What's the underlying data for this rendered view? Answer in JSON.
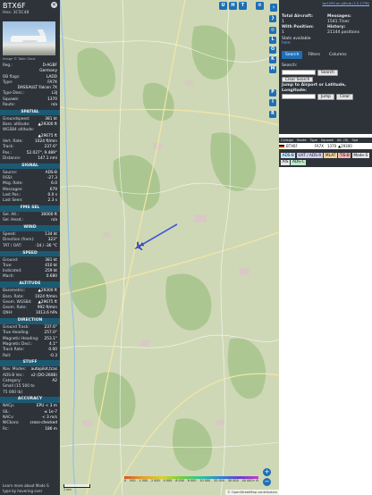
{
  "infoblock": {
    "callsign": "BTX6F",
    "hex_line": "Hex: 3C5C48",
    "photo_credit": "Image © Tobin Zouk",
    "ident_rows": [
      {
        "k": "Reg.:",
        "v": "D-AGBF"
      },
      {
        "k": "",
        "v": "Germany"
      },
      {
        "k": "DB flags:",
        "v": "LADD"
      },
      {
        "k": "Type:",
        "v": "FA7X"
      },
      {
        "k": "",
        "v": "DASSAULT Falcon 7X"
      },
      {
        "k": "Type Desc.:",
        "v": "L3J"
      },
      {
        "k": "Squawk:",
        "v": "1370"
      },
      {
        "k": "Route:",
        "v": "n/a"
      }
    ],
    "sections": [
      {
        "title": "SPATIAL",
        "rows": [
          {
            "k": "Groundspeed:",
            "v": "381 kt"
          },
          {
            "k": "Baro. altitude:",
            "v": "▲29300 ft"
          },
          {
            "k": "WGS84 altitude:",
            "v": ""
          },
          {
            "k": "",
            "v": "▲29675 ft"
          },
          {
            "k": "Vert. Rate:",
            "v": "1024 ft/min"
          },
          {
            "k": "Track:",
            "v": "237.6°"
          },
          {
            "k": "Pos.:",
            "v": "52.027°, 9.489°"
          },
          {
            "k": "Distance:",
            "v": "147.1 nmi"
          }
        ]
      },
      {
        "title": "SIGNAL",
        "rows": [
          {
            "k": "Source:",
            "v": "ADS-B"
          },
          {
            "k": "RSSI:",
            "v": "-27.3"
          },
          {
            "k": "Msg. Rate:",
            "v": "6.0"
          },
          {
            "k": "Messages:",
            "v": "679"
          },
          {
            "k": "Last Pos.:",
            "v": "0.0 s"
          },
          {
            "k": "Last Seen:",
            "v": "2.3 s"
          }
        ]
      },
      {
        "title": "FMS SEL",
        "rows": [
          {
            "k": "Sel. Alt.:",
            "v": "30000 ft"
          },
          {
            "k": "Sel. Head.:",
            "v": "n/a"
          }
        ]
      },
      {
        "title": "WIND",
        "rows": [
          {
            "k": "Speed:",
            "v": "134 kt"
          },
          {
            "k": "Direction (from):",
            "v": "323°"
          },
          {
            "k": "TAT / OAT:",
            "v": "-14 / -36 °C"
          }
        ]
      },
      {
        "title": "SPEED",
        "rows": [
          {
            "k": "Ground:",
            "v": "381 kt"
          },
          {
            "k": "True:",
            "v": "410 kt"
          },
          {
            "k": "Indicated:",
            "v": "259 kt"
          },
          {
            "k": "Mach:",
            "v": "0.680"
          }
        ]
      },
      {
        "title": "ALTITUDE",
        "rows": [
          {
            "k": "Barometric:",
            "v": "▲29300 ft"
          },
          {
            "k": "Baro. Rate:",
            "v": "1024 ft/min"
          },
          {
            "k": "Geom. WGS84:",
            "v": "▲29675 ft"
          },
          {
            "k": "Geom. Rate:",
            "v": "992 ft/min"
          },
          {
            "k": "QNH:",
            "v": "1013.6 hPa"
          }
        ]
      },
      {
        "title": "DIRECTION",
        "rows": [
          {
            "k": "Ground Track:",
            "v": "237.6°"
          },
          {
            "k": "True Heading:",
            "v": "257.0°"
          },
          {
            "k": "Magnetic Heading:",
            "v": "253.1°"
          },
          {
            "k": "Magnetic Decl.:",
            "v": "4.1°"
          },
          {
            "k": "Track Rate:",
            "v": "0.00"
          },
          {
            "k": "Roll:",
            "v": "-0.3"
          }
        ]
      },
      {
        "title": "STUFF",
        "rows": [
          {
            "k": "Nav. Modes:",
            "v": "autopilot,tcas"
          },
          {
            "k": "ADS-B Ver.:",
            "v": "v2 (DO-260B)"
          },
          {
            "k": "Category:",
            "v": "A2"
          },
          {
            "k": "Small (15 500 to",
            "v": ""
          },
          {
            "k": "75 000 lb)",
            "v": ""
          }
        ]
      },
      {
        "title": "ACCURACY",
        "rows": [
          {
            "k": "NACp:",
            "v": "EPU < 3 m"
          },
          {
            "k": "SIL:",
            "v": "≤ 1e-7"
          },
          {
            "k": "NACv:",
            "v": "< 3 m/s"
          },
          {
            "k": "NICbaro:",
            "v": "cross-checked"
          },
          {
            "k": "Rc:",
            "v": "186 m"
          }
        ]
      }
    ],
    "footer": "Learn more about Mode S type by hovering over"
  },
  "map": {
    "top_buttons": [
      "U",
      "H",
      "T"
    ],
    "side_buttons": [
      "L",
      "O",
      "K",
      "M",
      "P",
      "I",
      "R"
    ],
    "zoom_in": "+",
    "zoom_out": "−",
    "expand_arrow": "›",
    "scale_label": "2 km",
    "attribution": "© OpenStreetMap contributors",
    "altitude_legend": [
      "0",
      "500",
      "1 000",
      "2 000",
      "4 000",
      "6 000",
      "8 000",
      "10 000",
      "20 000",
      "30 000",
      "40 000+ ft"
    ],
    "track_color": "#3f58d6"
  },
  "sidebar": {
    "github_link": "tar1090 on github (1.0.1778)",
    "stats": [
      {
        "label": "Total Aircraft:",
        "value": "1"
      },
      {
        "label": "Messages:",
        "value": "1541.7/sec"
      },
      {
        "label": "With Position:",
        "value": "1"
      },
      {
        "label": "History:",
        "value": "21144 positions"
      }
    ],
    "stats_link": "Stats available",
    "stats_sub": "here",
    "tabs": [
      "Search",
      "Filters",
      "Columns"
    ],
    "search_label": "Search:",
    "search_button": "Search",
    "clear_search": "Clear Search",
    "jump_label": "Jump to Airport or Latitude, Longitude:",
    "jump_button": "Jump",
    "clear_button": "Clear",
    "table_headers": [
      "Callsign",
      "Route",
      "Type",
      "Squawk",
      "Alt. (ft)",
      "Spd"
    ],
    "table_row": {
      "callsign": "BTX6F",
      "type": "FA7X",
      "squawk": "1370",
      "alt": "▲29300"
    },
    "sources": [
      {
        "label": "ADS-B",
        "color": "#c8e6ff"
      },
      {
        "label": "UAT / ADS-R",
        "color": "#d6d0f2"
      },
      {
        "label": "MLAT",
        "color": "#f4d39a"
      },
      {
        "label": "TIS-B",
        "color": "#f5b3b3"
      },
      {
        "label": "Mode-S",
        "color": "#e6e6e6"
      },
      {
        "label": "AIS",
        "color": "#e6e6e6"
      },
      {
        "label": "ADS-C",
        "color": "#bfe8c9"
      }
    ]
  }
}
